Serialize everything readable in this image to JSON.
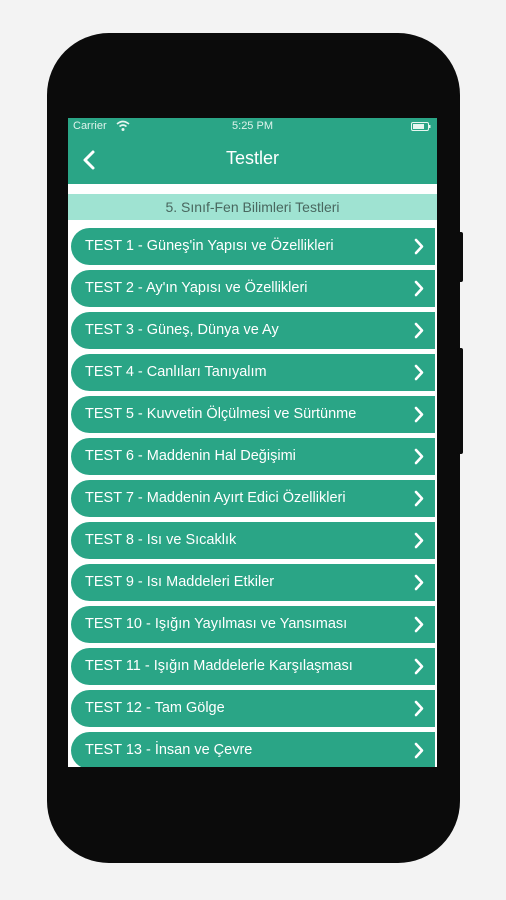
{
  "status_bar": {
    "carrier": "Carrier",
    "time": "5:25 PM"
  },
  "nav": {
    "title": "Testler",
    "back_icon": "chevron-left-icon"
  },
  "section": {
    "header": "5. Sınıf-Fen Bilimleri Testleri"
  },
  "tests": [
    {
      "label": "TEST 1 - Güneş'in Yapısı ve Özellikleri"
    },
    {
      "label": "TEST 2 - Ay'ın Yapısı ve Özellikleri"
    },
    {
      "label": "TEST 3 - Güneş, Dünya ve Ay"
    },
    {
      "label": "TEST 4 - Canlıları Tanıyalım"
    },
    {
      "label": "TEST 5 - Kuvvetin Ölçülmesi ve Sürtünme"
    },
    {
      "label": "TEST 6 - Maddenin Hal Değişimi"
    },
    {
      "label": "TEST 7 - Maddenin Ayırt Edici Özellikleri"
    },
    {
      "label": "TEST 8 - Isı ve Sıcaklık"
    },
    {
      "label": "TEST 9 - Isı Maddeleri Etkiler"
    },
    {
      "label": "TEST 10 - Işığın Yayılması ve Yansıması"
    },
    {
      "label": "TEST 11 - Işığın Maddelerle Karşılaşması"
    },
    {
      "label": "TEST 12 - Tam Gölge"
    },
    {
      "label": "TEST 13 - İnsan ve Çevre"
    }
  ],
  "colors": {
    "accent": "#2aa586",
    "section_bg": "#9fe3d2",
    "section_text": "#49675f"
  }
}
